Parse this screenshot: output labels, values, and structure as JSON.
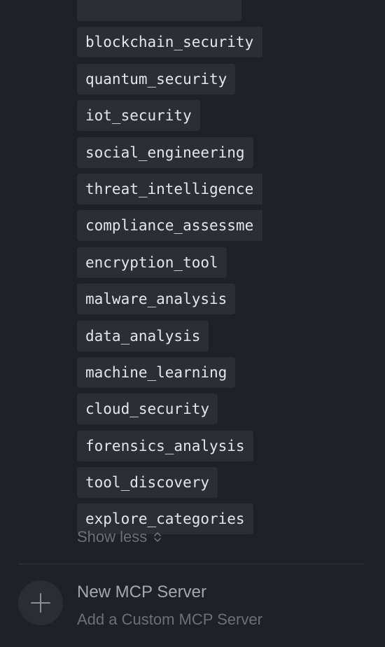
{
  "tools": [
    {
      "label": "",
      "clipped": false
    },
    {
      "label": "blockchain_security",
      "clipped": true
    },
    {
      "label": "quantum_security",
      "clipped": false
    },
    {
      "label": "iot_security",
      "clipped": false
    },
    {
      "label": "social_engineering",
      "clipped": false
    },
    {
      "label": "threat_intelligence",
      "clipped": true
    },
    {
      "label": "compliance_assessme",
      "clipped": true
    },
    {
      "label": "encryption_tool",
      "clipped": false
    },
    {
      "label": "malware_analysis",
      "clipped": false
    },
    {
      "label": "data_analysis",
      "clipped": false
    },
    {
      "label": "machine_learning",
      "clipped": false
    },
    {
      "label": "cloud_security",
      "clipped": false
    },
    {
      "label": "forensics_analysis",
      "clipped": false
    },
    {
      "label": "tool_discovery",
      "clipped": false
    },
    {
      "label": "explore_categories",
      "clipped": false
    }
  ],
  "show_less": {
    "label": "Show less",
    "icon": "chevron-up-down-icon"
  },
  "new_server": {
    "title": "New MCP Server",
    "subtitle": "Add a Custom MCP Server",
    "icon": "plus-icon"
  },
  "colors": {
    "background": "#1f2127",
    "tag_background": "#2b2e35",
    "tag_text": "#e4e6ea",
    "muted_text": "#6b7079",
    "title_text": "#a3a7ae"
  }
}
